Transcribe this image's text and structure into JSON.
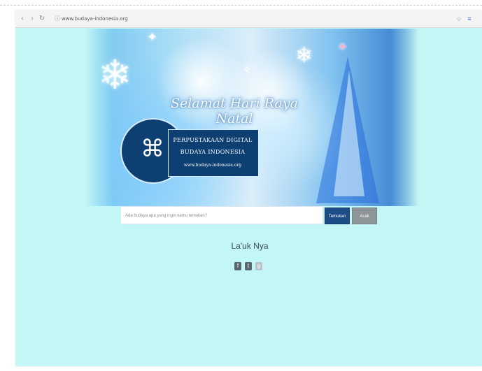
{
  "browser": {
    "url": "www.budaya-indonesia.org",
    "buttons": {
      "back": "‹",
      "forward": "›",
      "reload": "↻",
      "url_icon": "ⓘ",
      "star": "☆",
      "menu": "≡"
    }
  },
  "banner": {
    "greeting": "Selamat Hari Raya Natal",
    "logo": {
      "line1": "PERPUSTAKAAN DIGITAL",
      "line2": "BUDAYA INDONESIA",
      "line3": "www.budaya-indonesia.org",
      "map_glyph": "⌘"
    }
  },
  "search": {
    "placeholder": "Ada budaya apa yang ingin kamu temukan?",
    "search_label": "Temukan",
    "random_label": "Acak"
  },
  "section": {
    "title": "La'uk Nya"
  },
  "social": {
    "facebook": "f",
    "twitter": "t",
    "google": "g"
  },
  "colors": {
    "page_background": "#c2f7f5",
    "primary_button": "#1d4d86",
    "secondary_button": "#8e9598"
  }
}
